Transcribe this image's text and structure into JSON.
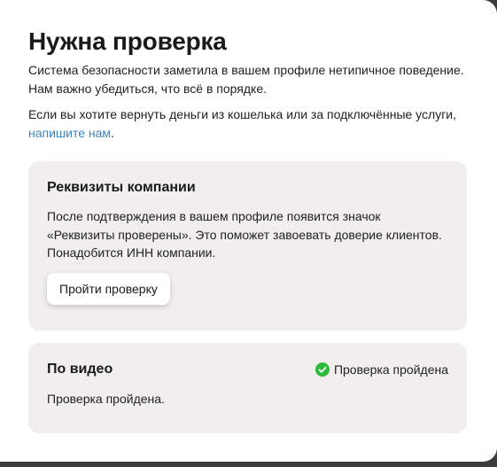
{
  "modal": {
    "title": "Нужна проверка",
    "paragraph1": "Система безопасности заметила в вашем профиле нетипичное поведение. Нам важно убедиться, что всё в порядке.",
    "paragraph2_prefix": "Если вы хотите вернуть деньги из кошелька или за подключённые услуги, ",
    "paragraph2_link": "напишите нам",
    "paragraph2_suffix": "."
  },
  "company_card": {
    "title": "Реквизиты компании",
    "text": "После подтверждения в вашем профиле появится значок «Реквизиты проверены». Это поможет завоевать доверие клиентов. Понадобится ИНН компании.",
    "button_label": "Пройти проверку"
  },
  "video_card": {
    "title": "По видео",
    "status_label": "Проверка пройдена",
    "status_icon": "check-circle-icon",
    "status_color": "#2dbb3b",
    "text": "Проверка пройдена."
  },
  "colors": {
    "link": "#3a86c8",
    "card_bg": "#f0efed",
    "success": "#2dbb3b"
  }
}
